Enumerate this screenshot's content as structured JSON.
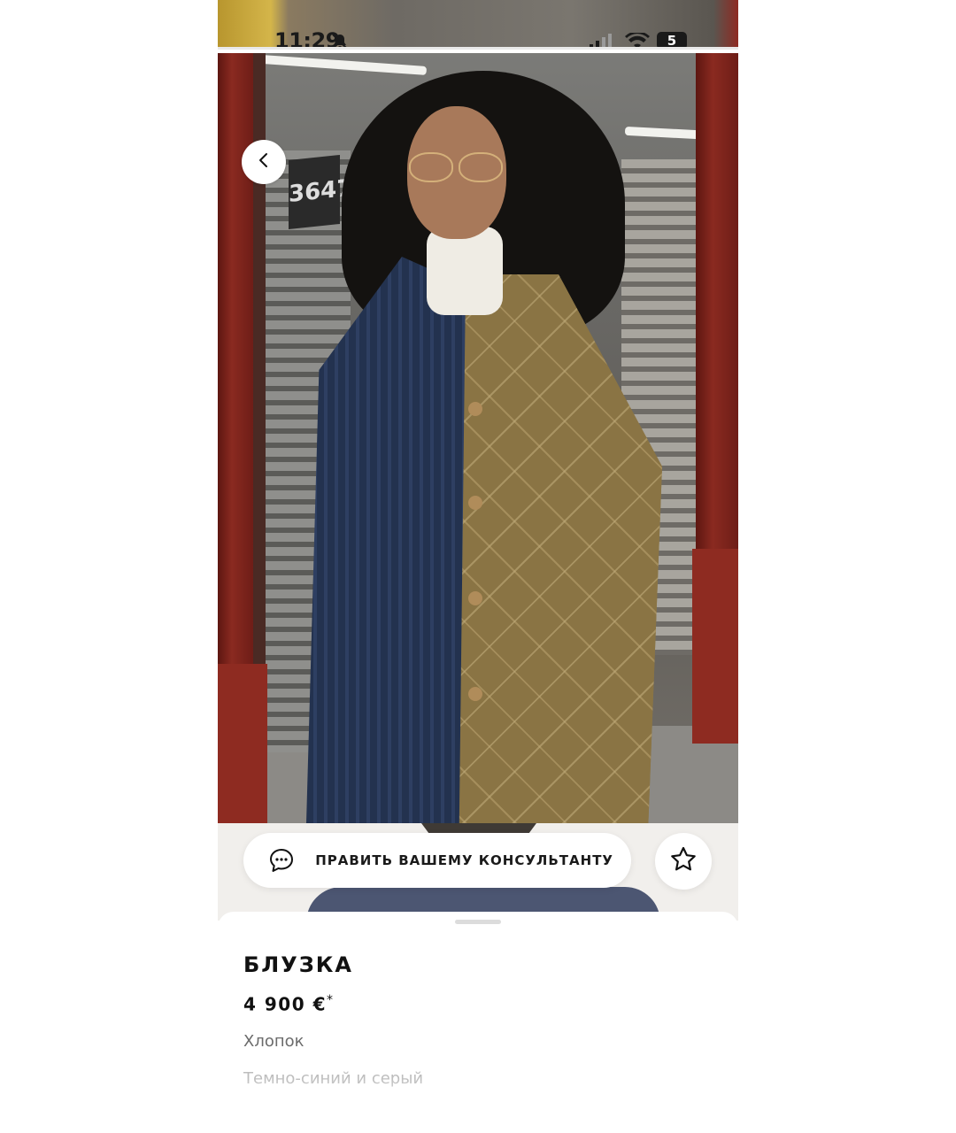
{
  "status_bar": {
    "time": "11:29",
    "battery": "5",
    "icons": [
      "bell-muted-icon",
      "cellular-signal-icon",
      "wifi-icon",
      "battery-icon"
    ]
  },
  "navigation": {
    "back_icon": "chevron-left-icon"
  },
  "actions": {
    "contact_label": "ОТПРАВИТЬ ВАШЕМУ КОНСУЛЬТАНТУ",
    "contact_icon": "chat-bubble-icon",
    "favorite_icon": "star-outline-icon"
  },
  "product": {
    "name": "БЛУЗКА",
    "price": "4 900 €",
    "price_note": "*",
    "material": "Хлопок",
    "color": "Темно-синий и серый"
  },
  "colors": {
    "accent": "#111111",
    "secondary_text": "#6b6b6b"
  }
}
